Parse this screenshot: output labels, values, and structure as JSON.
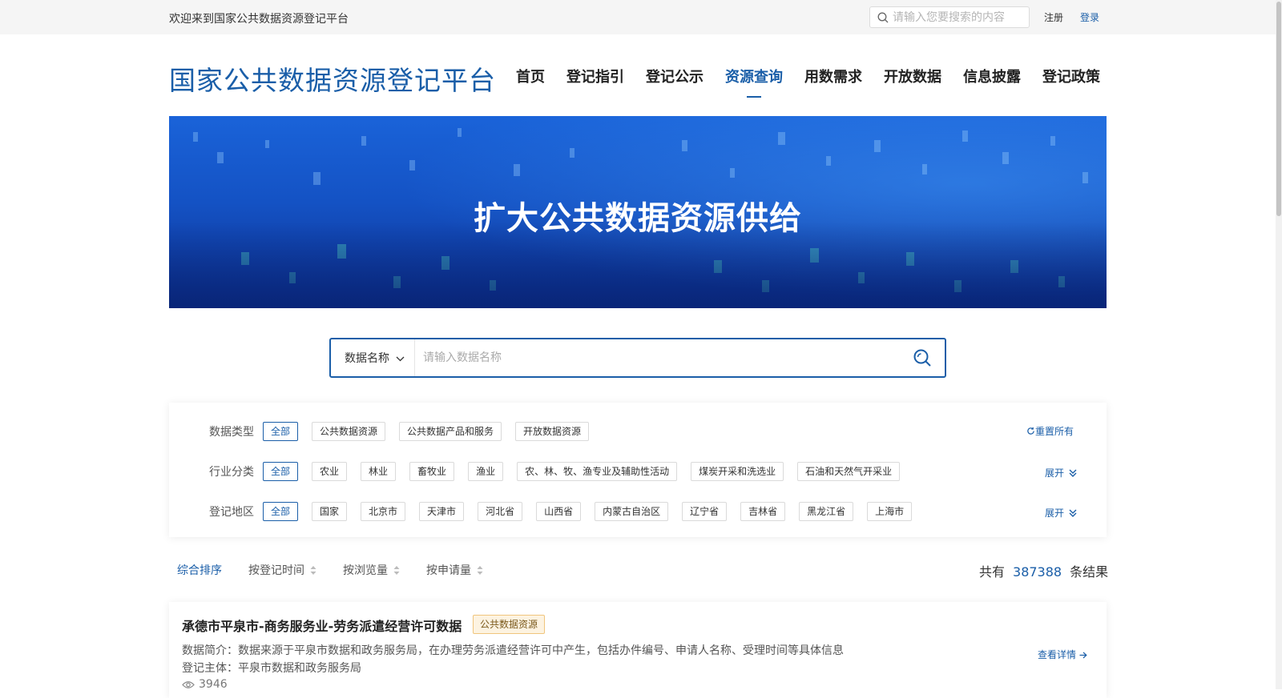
{
  "topbar": {
    "welcome": "欢迎来到国家公共数据资源登记平台",
    "search_placeholder": "请输入您要搜索的内容",
    "register": "注册",
    "login": "登录"
  },
  "header": {
    "logo": "国家公共数据资源登记平台",
    "nav": [
      "首页",
      "登记指引",
      "登记公示",
      "资源查询",
      "用数需求",
      "开放数据",
      "信息披露",
      "登记政策"
    ],
    "active_nav": "资源查询"
  },
  "banner": {
    "title": "扩大公共数据资源供给"
  },
  "search": {
    "type_label": "数据名称",
    "placeholder": "请输入数据名称"
  },
  "filters": {
    "reset_label": "重置所有",
    "expand_label": "展开",
    "rows": [
      {
        "label": "数据类型",
        "tags": [
          "全部",
          "公共数据资源",
          "公共数据产品和服务",
          "开放数据资源"
        ]
      },
      {
        "label": "行业分类",
        "tags": [
          "全部",
          "农业",
          "林业",
          "畜牧业",
          "渔业",
          "农、林、牧、渔专业及辅助性活动",
          "煤炭开采和洗选业",
          "石油和天然气开采业"
        ]
      },
      {
        "label": "登记地区",
        "tags": [
          "全部",
          "国家",
          "北京市",
          "天津市",
          "河北省",
          "山西省",
          "内蒙古自治区",
          "辽宁省",
          "吉林省",
          "黑龙江省",
          "上海市"
        ]
      }
    ]
  },
  "sort": {
    "items": [
      "综合排序",
      "按登记时间",
      "按浏览量",
      "按申请量"
    ],
    "result_prefix": "共有",
    "result_count": "387388",
    "result_suffix": "条结果"
  },
  "results": [
    {
      "title": "承德市平泉市-商务服务业-劳务派遣经营许可数据",
      "badge": "公共数据资源",
      "desc": "数据简介：数据来源于平泉市数据和政务服务局，在办理劳务派遣经营许可中产生，包括办件编号、申请人名称、受理时间等具体信息",
      "owner": "登记主体：平泉市数据和政务服务局",
      "views": "3946",
      "detail_label": "查看详情"
    }
  ],
  "colors": {
    "brand": "#1a5ea8",
    "badge_bg": "#fdf3e1",
    "badge_border": "#f0c57d"
  }
}
